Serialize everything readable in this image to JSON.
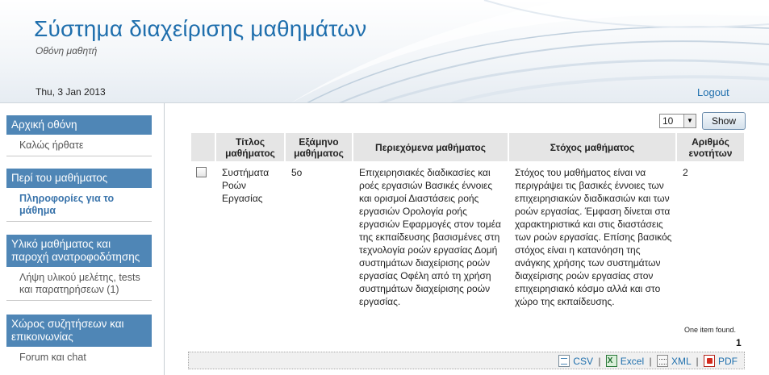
{
  "header": {
    "title": "Σύστημα διαχείρισης μαθημάτων",
    "subtitle": "Οθόνη μαθητή",
    "date": "Thu, 3 Jan 2013",
    "logout_label": "Logout"
  },
  "sidebar": {
    "sections": [
      {
        "heading": "Αρχική οθόνη",
        "items": [
          {
            "label": "Καλώς ήρθατε",
            "active": false
          }
        ]
      },
      {
        "heading": "Περί του μαθήματος",
        "items": [
          {
            "label": "Πληροφορίες για το μάθημα",
            "active": true
          }
        ]
      },
      {
        "heading": "Υλικό μαθήματος και παροχή ανατροφοδότησης",
        "items": [
          {
            "label": "Λήψη υλικού μελέτης, tests και παρατηρήσεων (1)",
            "active": false
          }
        ]
      },
      {
        "heading": "Χώρος συζητήσεων και επικοινωνίας",
        "items": [
          {
            "label": "Forum και chat",
            "active": false
          }
        ]
      }
    ]
  },
  "pager": {
    "page_size": "10",
    "show_label": "Show"
  },
  "table": {
    "headers": [
      "Τίτλος μαθήματος",
      "Εξάμηνο μαθήματος",
      "Περιεχόμενα μαθήματος",
      "Στόχος μαθήματος",
      "Αριθμός ενοτήτων"
    ],
    "rows": [
      {
        "title": "Συστήματα Ροών Εργασίας",
        "semester": "5ο",
        "contents": "Επιχειρησιακές διαδικασίες και ροές εργασιών Βασικές έννοιες και ορισμοί Διαστάσεις ροής εργασιών Ορολογία ροής εργασιών Εφαρμογές στον τομέα της εκπαίδευσης βασισμένες στη τεχνολογία ροών εργασίας Δομή συστημάτων διαχείρισης ροών εργασίας Οφέλη από τη χρήση συστημάτων διαχείρισης ροών εργασίας.",
        "goal": "Στόχος του μαθήματος είναι να περιγράψει τις βασικές έννοιες των επιχειρησιακών διαδικασιών και των ροών εργασίας. Έμφαση δίνεται στα χαρακτηριστικά και στις διαστάσεις των ροών εργασίας. Επίσης βασικός στόχος είναι η κατανόηση της ανάγκης χρήσης των συστημάτων διαχείρισης ροών εργασίας στον επιχειρησιακό κόσμο αλλά και στο χώρο της εκπαίδευσης.",
        "units": "2"
      }
    ],
    "items_found": "One item found.",
    "page": "1"
  },
  "export": {
    "csv": "CSV",
    "excel": "Excel",
    "xml": "XML",
    "pdf": "PDF",
    "separator": "|"
  }
}
